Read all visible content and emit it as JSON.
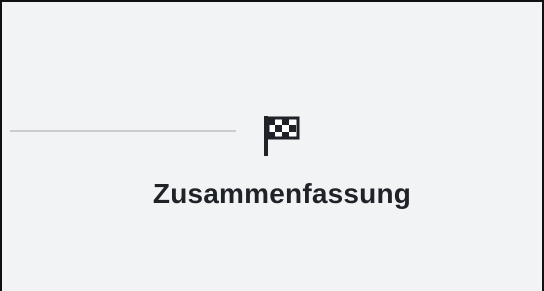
{
  "stepper": {
    "current_step": {
      "icon": "checkered-flag-icon",
      "label": "Zusammenfassung"
    }
  },
  "colors": {
    "background": "#f2f3f5",
    "line": "#c9ccd1",
    "text": "#1f2328"
  }
}
